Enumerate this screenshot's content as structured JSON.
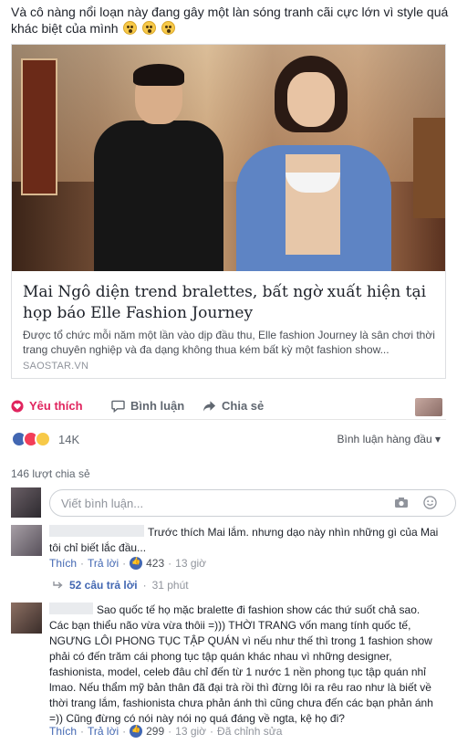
{
  "post": {
    "text": "Và cô nàng nổi loạn này đang gây một làn sóng tranh cãi cực lớn vì style quá khác biệt của mình",
    "emoji": [
      "wow-emoji",
      "wow-emoji",
      "wow-emoji"
    ]
  },
  "link_card": {
    "title": "Mai Ngô diện trend bralettes, bất ngờ xuất hiện tại họp báo Elle Fashion Journey",
    "description": "Được tổ chức mỗi năm một lần vào dịp đầu thu, Elle fashion Journey là sân chơi thời trang chuyên nghiệp và đa dạng không thua kém bất kỳ một fashion show...",
    "source": "SAOSTAR.VN"
  },
  "actions": {
    "like": "Yêu thích",
    "comment": "Bình luận",
    "share": "Chia sẻ"
  },
  "reactions": {
    "count": "14K",
    "sort": "Bình luận hàng đầu ▾",
    "shares": "146 lượt chia sẻ",
    "colors": {
      "like": "#4267b2",
      "love": "#f33e58",
      "haha": "#f7c948"
    }
  },
  "write_comment": {
    "placeholder": "Viết bình luận..."
  },
  "comments": [
    {
      "text": "Trước thích Mai lắm. nhưng dạo này nhìn những gì của Mai tôi chỉ biết lắc đầu...",
      "like_label": "Thích",
      "reply_label": "Trả lời",
      "likes": "423",
      "time": "13 giờ",
      "replies_label": "52 câu trả lời",
      "replies_time": "31 phút"
    },
    {
      "text": "Sao quốc tế họ mặc bralette đi fashion show các thứ suốt chả sao. Các bạn thiểu não vừa vừa thôii =))) THỜI TRANG vốn mang tính quốc tế, NGƯNG LÔI PHONG TỤC TẬP QUÁN vì nếu như thế thì trong 1 fashion show phải có đến trăm cái phong tục tập quán khác nhau vì những designer, fashionista, model, celeb đâu chỉ đến từ 1 nước 1 nền phong tục tập quán nhỉ lmao. Nếu thẩm mỹ bản thân đã đại trà rồi thì đừng lôi ra rêu rao như là biết về thời trang lắm, fashionista chưa phản ánh thì cũng chưa đến các bạn phản ánh =)) Cũng đừng có nói này nói nọ quá đáng về ngta, kệ họ đi?",
      "like_label": "Thích",
      "reply_label": "Trả lời",
      "likes": "299",
      "time": "13 giờ",
      "edited": "Đã chỉnh sửa"
    }
  ]
}
